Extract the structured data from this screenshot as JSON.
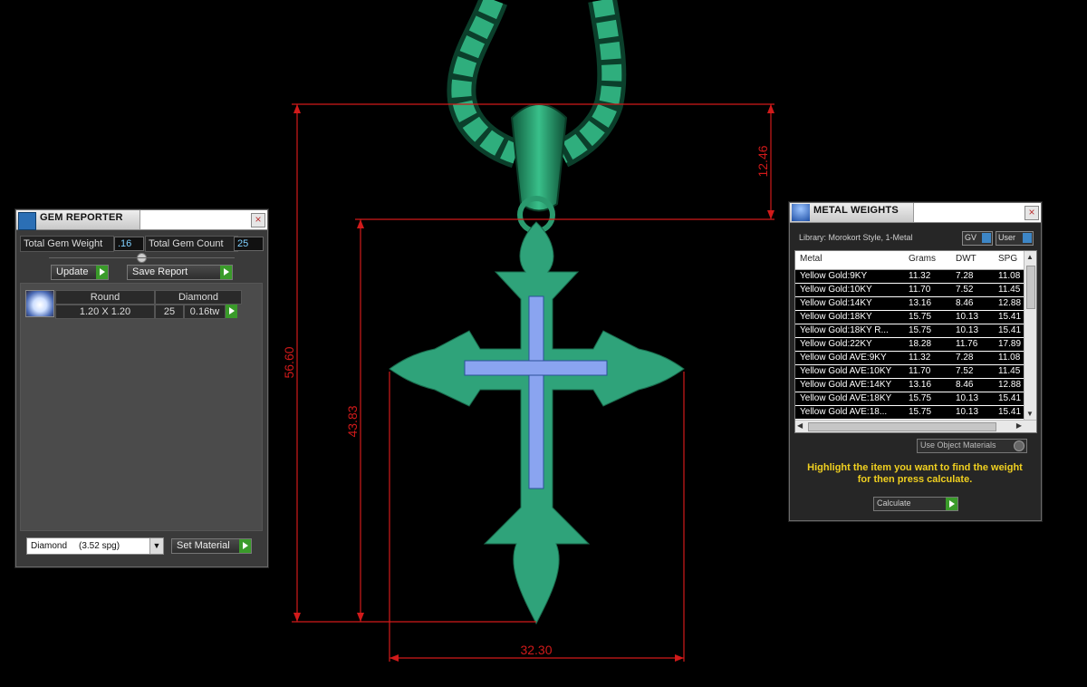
{
  "dimensions": {
    "total_height": "56.60",
    "body_height": "43.83",
    "bail_height": "12.46",
    "width": "32.30"
  },
  "gem_reporter": {
    "title": "GEM REPORTER",
    "total_gem_weight_label": "Total Gem Weight",
    "total_gem_weight_value": ".16",
    "total_gem_count_label": "Total Gem Count",
    "total_gem_count_value": "25",
    "update_label": "Update",
    "save_report_label": "Save Report",
    "gem_row": {
      "shape": "Round",
      "material": "Diamond",
      "size": "1.20 X 1.20",
      "count": "25",
      "weight": "0.16tw"
    },
    "material_select": "Diamond",
    "material_spg": "(3.52 spg)",
    "set_material_label": "Set Material"
  },
  "metal_weights": {
    "title": "METAL WEIGHTS",
    "library_text": "Library: Morokort Style, 1-Metal",
    "gv_label": "GV",
    "user_label": "User",
    "columns": [
      "Metal",
      "Grams",
      "DWT",
      "SPG"
    ],
    "rows": [
      [
        "Yellow Gold:9KY",
        "11.32",
        "7.28",
        "11.08"
      ],
      [
        "Yellow Gold:10KY",
        "11.70",
        "7.52",
        "11.45"
      ],
      [
        "Yellow Gold:14KY",
        "13.16",
        "8.46",
        "12.88"
      ],
      [
        "Yellow Gold:18KY",
        "15.75",
        "10.13",
        "15.41"
      ],
      [
        "Yellow Gold:18KY R...",
        "15.75",
        "10.13",
        "15.41"
      ],
      [
        "Yellow Gold:22KY",
        "18.28",
        "11.76",
        "17.89"
      ],
      [
        "Yellow Gold AVE:9KY",
        "11.32",
        "7.28",
        "11.08"
      ],
      [
        "Yellow Gold AVE:10KY",
        "11.70",
        "7.52",
        "11.45"
      ],
      [
        "Yellow Gold AVE:14KY",
        "13.16",
        "8.46",
        "12.88"
      ],
      [
        "Yellow Gold AVE:18KY",
        "15.75",
        "10.13",
        "15.41"
      ],
      [
        "Yellow Gold AVE:18...",
        "15.75",
        "10.13",
        "15.41"
      ]
    ],
    "use_object_materials": "Use Object Materials",
    "hint": "Highlight the item you want to find the weight for then press calculate.",
    "calculate_label": "Calculate"
  },
  "colors": {
    "model": "#2fa37a",
    "gems": "#6e8ee8",
    "dimension": "#d11a1a",
    "hint": "#f0d020"
  }
}
